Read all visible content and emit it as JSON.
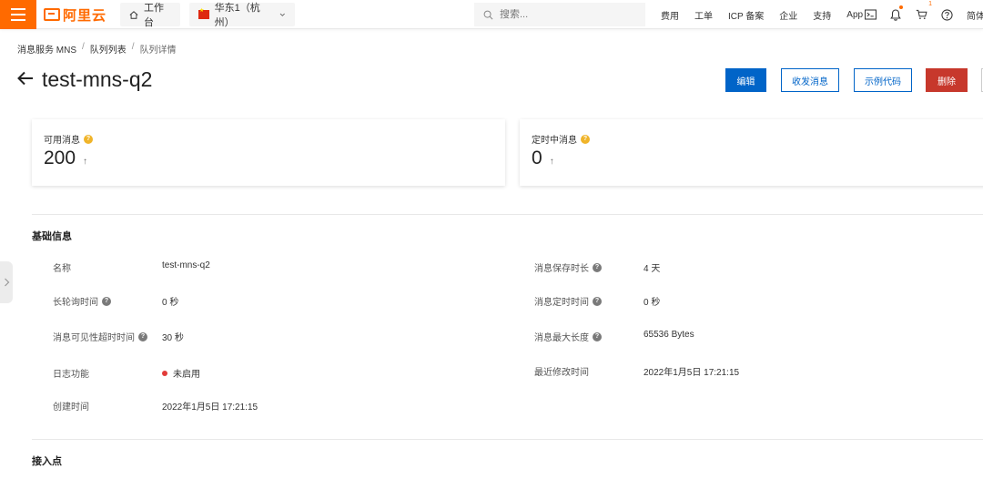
{
  "topbar": {
    "logo_text": "阿里云",
    "workbench_label": "工作台",
    "region_label": "华东1（杭州）",
    "search_placeholder": "搜索...",
    "links": [
      "费用",
      "工单",
      "ICP 备案",
      "企业",
      "支持",
      "App"
    ],
    "cart_badge": "1",
    "language_label": "简体"
  },
  "breadcrumb": [
    "消息服务 MNS",
    "队列列表",
    "队列详情"
  ],
  "page": {
    "title": "test-mns-q2"
  },
  "actions": {
    "edit": "编辑",
    "send_receive": "收发消息",
    "sample_code": "示例代码",
    "delete": "删除"
  },
  "stats": [
    {
      "label": "可用消息",
      "value": "200"
    },
    {
      "label": "定时中消息",
      "value": "0"
    }
  ],
  "basic_info": {
    "title": "基础信息",
    "fields": {
      "name": {
        "label": "名称",
        "value": "test-mns-q2"
      },
      "retention": {
        "label": "消息保存时长",
        "value": "4 天"
      },
      "long_poll": {
        "label": "长轮询时间",
        "value": "0 秒"
      },
      "delay": {
        "label": "消息定时时间",
        "value": "0 秒"
      },
      "visibility": {
        "label": "消息可见性超时时间",
        "value": "30 秒"
      },
      "max_size": {
        "label": "消息最大长度",
        "value": "65536 Bytes"
      },
      "logging": {
        "label": "日志功能",
        "value": "未启用"
      },
      "modified": {
        "label": "最近修改时间",
        "value": "2022年1月5日 17:21:15"
      },
      "created": {
        "label": "创建时间",
        "value": "2022年1月5日 17:21:15"
      }
    }
  },
  "endpoint_section": {
    "title": "接入点"
  },
  "colors": {
    "brand_orange": "#ff6a00",
    "primary_blue": "#0064c8",
    "danger_red": "#c7382c",
    "status_red": "#e23c39",
    "help_yellow": "#f0b429"
  }
}
